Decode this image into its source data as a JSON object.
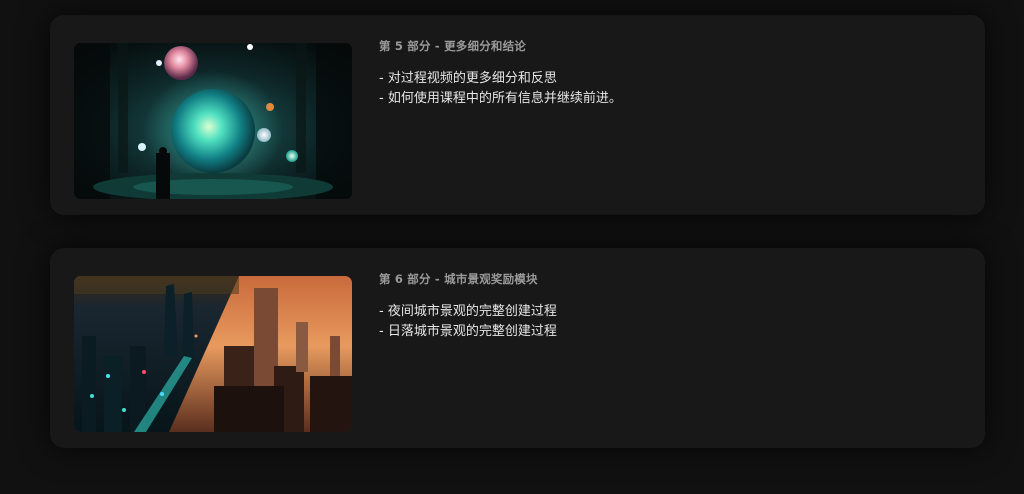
{
  "modules": [
    {
      "title": "第 5 部分 - 更多细分和结论",
      "image_alt": "sci-fi-spheres-illustration",
      "bullets": [
        "- 对过程视频的更多细分和反思",
        "- 如何使用课程中的所有信息并继续前进。"
      ]
    },
    {
      "title": "第 6 部分 - 城市景观奖励模块",
      "image_alt": "city-night-and-sunset-illustration",
      "bullets": [
        "- 夜间城市景观的完整创建过程",
        "- 日落城市景观的完整创建过程"
      ]
    }
  ],
  "colors": {
    "page_background": "#111111",
    "card_background": "#181818",
    "title_text": "#9a9a9a",
    "body_text": "#e6e6e6"
  }
}
